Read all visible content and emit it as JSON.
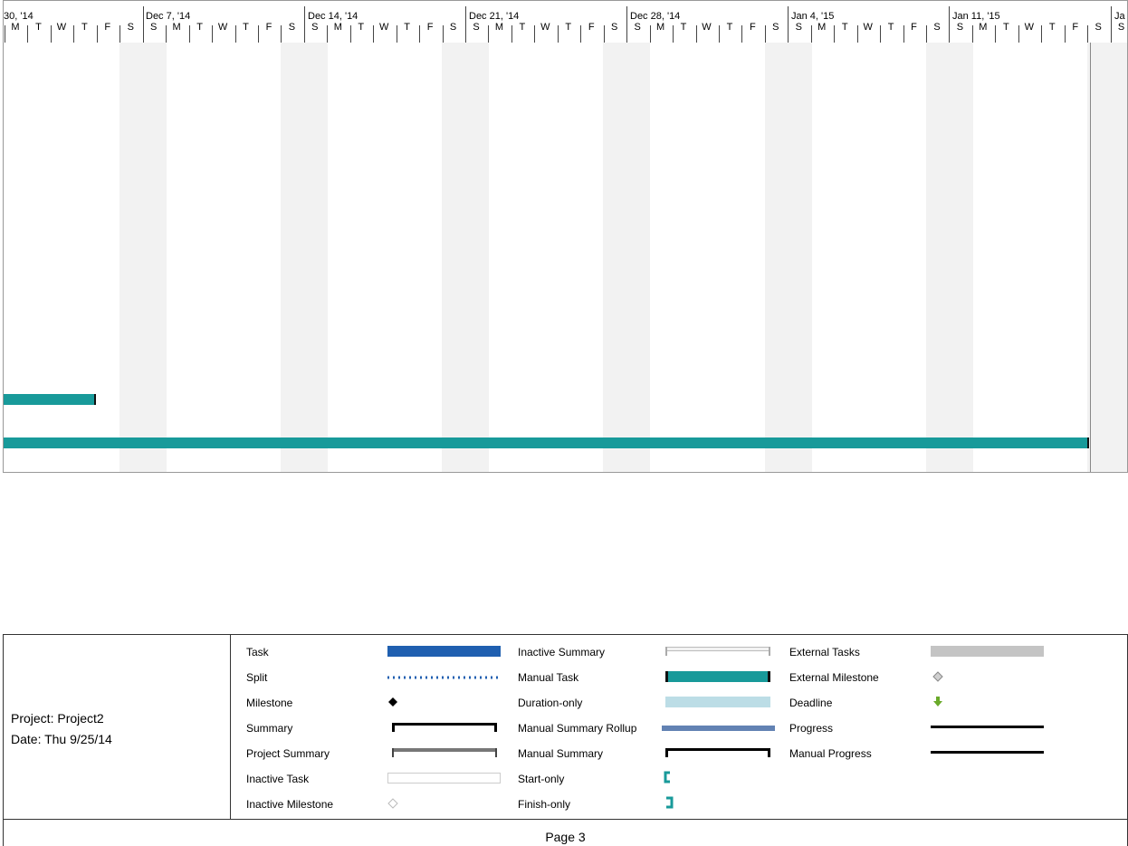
{
  "timescale": {
    "weeks": [
      {
        "label": "30, '14"
      },
      {
        "label": "Dec 7, '14"
      },
      {
        "label": "Dec 14, '14"
      },
      {
        "label": "Dec 21, '14"
      },
      {
        "label": "Dec 28, '14"
      },
      {
        "label": "Jan 4, '15"
      },
      {
        "label": "Jan 11, '15"
      },
      {
        "label": "Ja"
      }
    ],
    "day_letters": [
      "S",
      "M",
      "T",
      "W",
      "T",
      "F",
      "S"
    ]
  },
  "gantt": {
    "tasks": [
      {
        "name": "task-bar-1",
        "type": "manual-task",
        "color": "#189a9a"
      },
      {
        "name": "task-bar-2",
        "type": "manual-task",
        "color": "#189a9a"
      }
    ]
  },
  "project_info": {
    "project": "Project: Project2",
    "date": "Date: Thu 9/25/14"
  },
  "legend": {
    "col1": [
      "Task",
      "Split",
      "Milestone",
      "Summary",
      "Project Summary",
      "Inactive Task",
      "Inactive Milestone"
    ],
    "col2": [
      "Inactive Summary",
      "Manual Task",
      "Duration-only",
      "Manual Summary Rollup",
      "Manual Summary",
      "Start-only",
      "Finish-only"
    ],
    "col3": [
      "External Tasks",
      "External Milestone",
      "Deadline",
      "Progress",
      "Manual Progress"
    ]
  },
  "footer": {
    "page": "Page 3"
  },
  "colors": {
    "task": "#1f5fb0",
    "manual_task": "#189a9a",
    "duration_only": "#bcdde6",
    "rollup": "#6282b3",
    "external": "#c4c4c4",
    "deadline": "#6aaa2a"
  }
}
